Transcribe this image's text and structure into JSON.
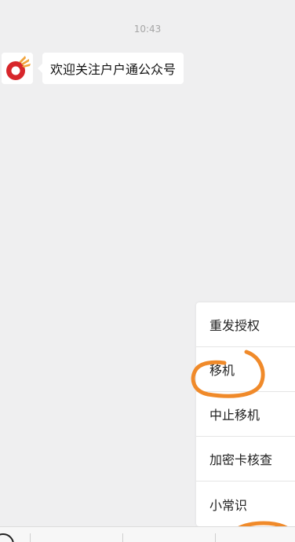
{
  "chat": {
    "timestamp": "10:43",
    "message": "欢迎关注户户通公众号",
    "avatar_icon": "huhutong-logo-icon"
  },
  "menu": {
    "items": [
      {
        "label": "重发授权"
      },
      {
        "label": "移机"
      },
      {
        "label": "中止移机"
      },
      {
        "label": "加密卡核查"
      },
      {
        "label": "小常识"
      }
    ]
  },
  "bottom_bar": {
    "keyboard_icon": "keyboard-toggle-icon"
  },
  "colors": {
    "annotation": "#f08a2a",
    "logo_red": "#d7262b",
    "logo_orange": "#f1a43c"
  }
}
